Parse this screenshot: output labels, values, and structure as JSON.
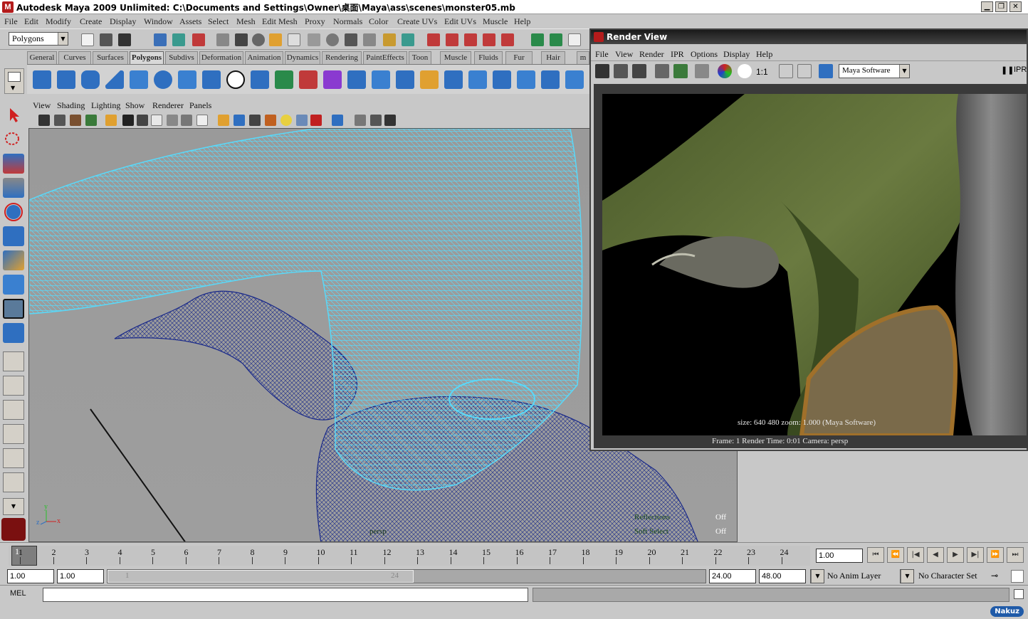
{
  "window": {
    "title": "Autodesk Maya 2009 Unlimited: C:\\Documents and Settings\\Owner\\桌面\\Maya\\ass\\scenes\\monster05.mb",
    "minimize": "▁",
    "restore": "❐",
    "close": "✕"
  },
  "menubar": [
    "File",
    "Edit",
    "Modify",
    "Create",
    "Display",
    "Window",
    "Assets",
    "Select",
    "Mesh",
    "Edit Mesh",
    "Proxy",
    "Normals",
    "Color",
    "Create UVs",
    "Edit UVs",
    "Muscle",
    "Help"
  ],
  "statusline": {
    "menu_set": "Polygons"
  },
  "shelf_tabs": [
    "General",
    "Curves",
    "Surfaces",
    "Polygons",
    "Subdivs",
    "Deformation",
    "Animation",
    "Dynamics",
    "Rendering",
    "PaintEffects",
    "Toon",
    "Muscle",
    "Fluids",
    "Fur",
    "Hair",
    "m"
  ],
  "shelf_active_tab": "Polygons",
  "panel_menu": [
    "View",
    "Shading",
    "Lighting",
    "Show",
    "Renderer",
    "Panels"
  ],
  "viewport": {
    "camera": "persp",
    "hud": [
      {
        "label": "Reflections",
        "value": "Off"
      },
      {
        "label": "Soft Select",
        "value": "Off"
      }
    ],
    "axis": {
      "x": "x",
      "y": "y",
      "z": "z"
    }
  },
  "render_view": {
    "title": "Render View",
    "menu": [
      "File",
      "View",
      "Render",
      "IPR",
      "Options",
      "Display",
      "Help"
    ],
    "ratio_label": "1:1",
    "renderer": "Maya Software",
    "ipr_label": "IPR",
    "info_line1": "size:  640  480 zoom: 1.000      (Maya Software)",
    "info_line2": "Frame: 1       Render Time: 0:01       Camera: persp"
  },
  "timeline": {
    "frames": [
      "1",
      "2",
      "3",
      "4",
      "5",
      "6",
      "7",
      "8",
      "9",
      "10",
      "11",
      "12",
      "13",
      "14",
      "15",
      "16",
      "17",
      "18",
      "19",
      "20",
      "21",
      "22",
      "23",
      "24"
    ],
    "current_frame": "1",
    "current_time": "1.00"
  },
  "range": {
    "start_time": "1.00",
    "range_start": "1.00",
    "slider_start": "1",
    "slider_end": "24",
    "range_end": "24.00",
    "end_time": "48.00",
    "anim_layer": "No Anim Layer",
    "character_set": "No Character Set"
  },
  "cmdline": {
    "mel_label": "MEL"
  },
  "watermark": "Nakuz"
}
